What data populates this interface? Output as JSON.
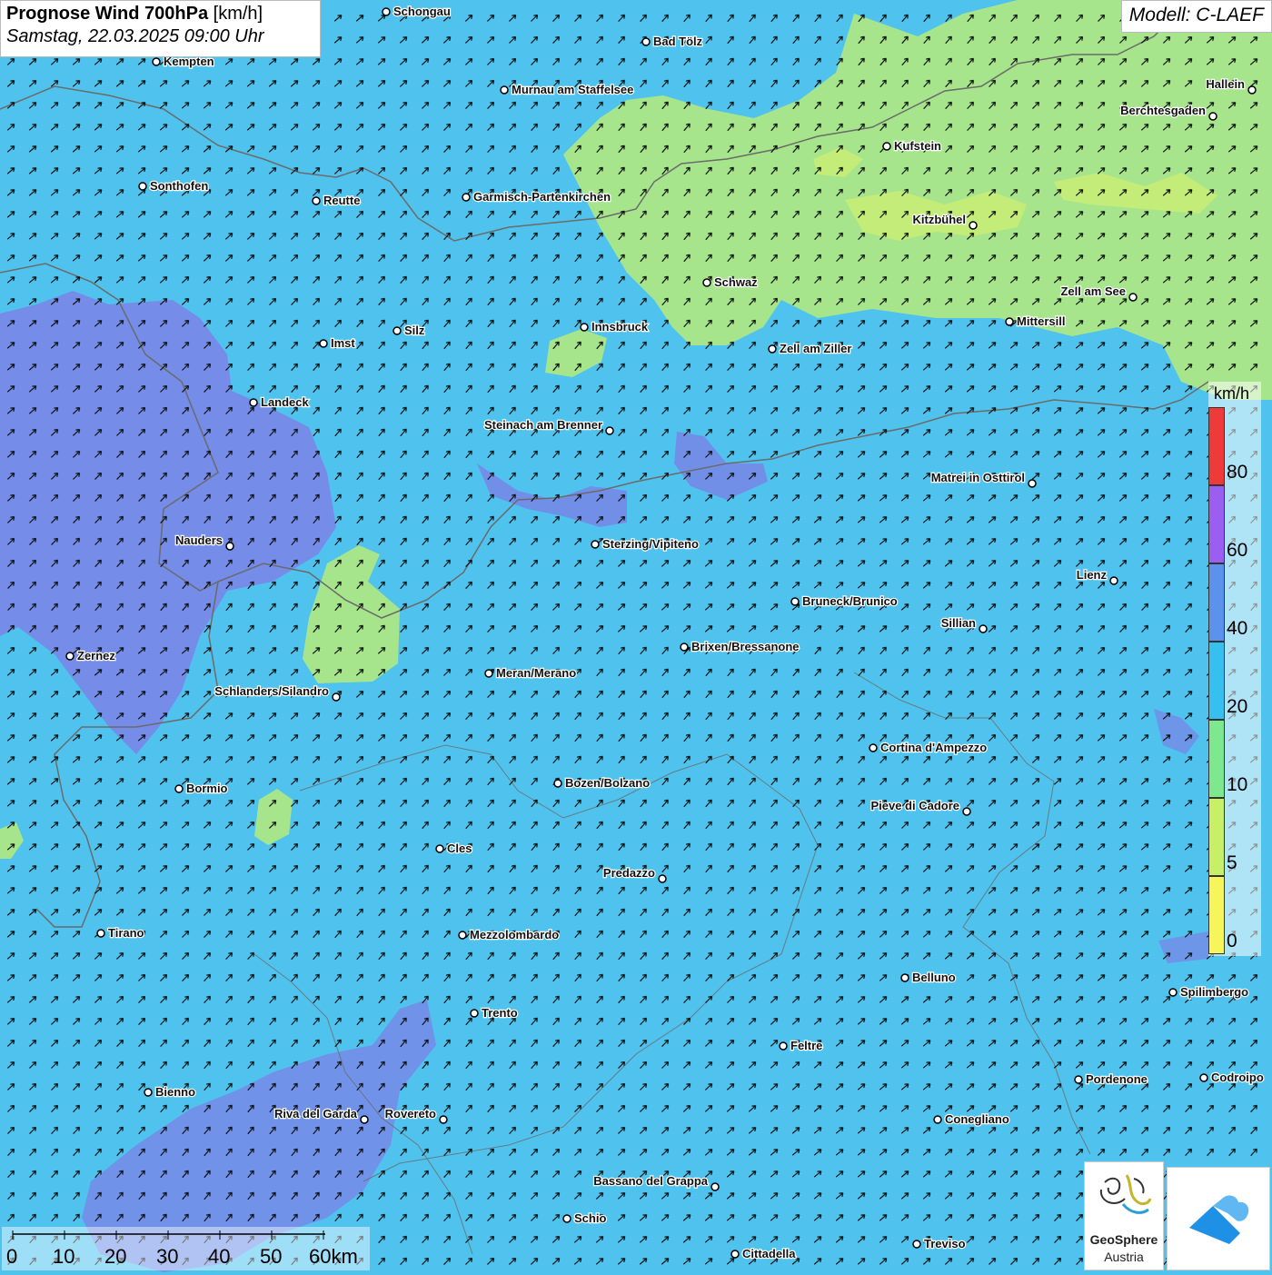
{
  "title": {
    "main": "Prognose Wind 700hPa",
    "unit": "[km/h]",
    "datetime": "Samstag, 22.03.2025 09:00 Uhr"
  },
  "model": "Modell: C-LAEF",
  "legend": {
    "unit": "km/h",
    "labels": [
      "80",
      "60",
      "40",
      "20",
      "10",
      "5",
      "0"
    ],
    "colors": {
      "80": "#ef3a3a",
      "60": "#9a5ff0",
      "40": "#5b93ec",
      "20": "#35c0ef",
      "10": "#7ee88e",
      "5": "#c7f067",
      "0": "#f6f65a"
    }
  },
  "map_colors": {
    "base": "#4fc3ee",
    "strong": "#7b82e6",
    "calm": "#a6e58b",
    "calm_light": "#c4ec78",
    "border": "#6b6b6b"
  },
  "wind_field": {
    "direction": "south-west to north-east"
  },
  "cities": [
    {
      "name": "Schongau"
    },
    {
      "name": "Bad Tölz"
    },
    {
      "name": "Kempten"
    },
    {
      "name": "Murnau am Staffelsee"
    },
    {
      "name": "Hallein"
    },
    {
      "name": "Berchtesgaden"
    },
    {
      "name": "Kufstein"
    },
    {
      "name": "Sonthofen"
    },
    {
      "name": "Reutte"
    },
    {
      "name": "Garmisch-Partenkirchen"
    },
    {
      "name": "Kitzbühel"
    },
    {
      "name": "Schwaz"
    },
    {
      "name": "Zell am See"
    },
    {
      "name": "Mittersill"
    },
    {
      "name": "Silz"
    },
    {
      "name": "Imst"
    },
    {
      "name": "Innsbruck"
    },
    {
      "name": "Zell am Ziller"
    },
    {
      "name": "Landeck"
    },
    {
      "name": "Steinach am Brenner"
    },
    {
      "name": "Matrei in Osttirol"
    },
    {
      "name": "Nauders"
    },
    {
      "name": "Sterzing/Vipiteno"
    },
    {
      "name": "Lienz"
    },
    {
      "name": "Bruneck/Brunico"
    },
    {
      "name": "Sillian"
    },
    {
      "name": "Brixen/Bressanone"
    },
    {
      "name": "Zernez"
    },
    {
      "name": "Meran/Merano"
    },
    {
      "name": "Schlanders/Silandro"
    },
    {
      "name": "Cortina d'Ampezzo"
    },
    {
      "name": "Bozen/Bolzano"
    },
    {
      "name": "Bormio"
    },
    {
      "name": "Pieve di Cadore"
    },
    {
      "name": "Cles"
    },
    {
      "name": "Predazzo"
    },
    {
      "name": "Tirano"
    },
    {
      "name": "Mezzolombardo"
    },
    {
      "name": "Belluno"
    },
    {
      "name": "Spilimbergo"
    },
    {
      "name": "Trento"
    },
    {
      "name": "Feltre"
    },
    {
      "name": "Pordenone"
    },
    {
      "name": "Codroipo"
    },
    {
      "name": "Bienno"
    },
    {
      "name": "Riva del Garda"
    },
    {
      "name": "Rovereto"
    },
    {
      "name": "Conegliano"
    },
    {
      "name": "Bassano del Grappa"
    },
    {
      "name": "Schio"
    },
    {
      "name": "Treviso"
    },
    {
      "name": "Cittadella"
    }
  ],
  "scale_bar": {
    "labels": [
      "0",
      "10",
      "20",
      "30",
      "40",
      "50",
      "60km"
    ]
  },
  "logos": {
    "geosphere_line1": "GeoSphere",
    "geosphere_line2": "Austria"
  }
}
